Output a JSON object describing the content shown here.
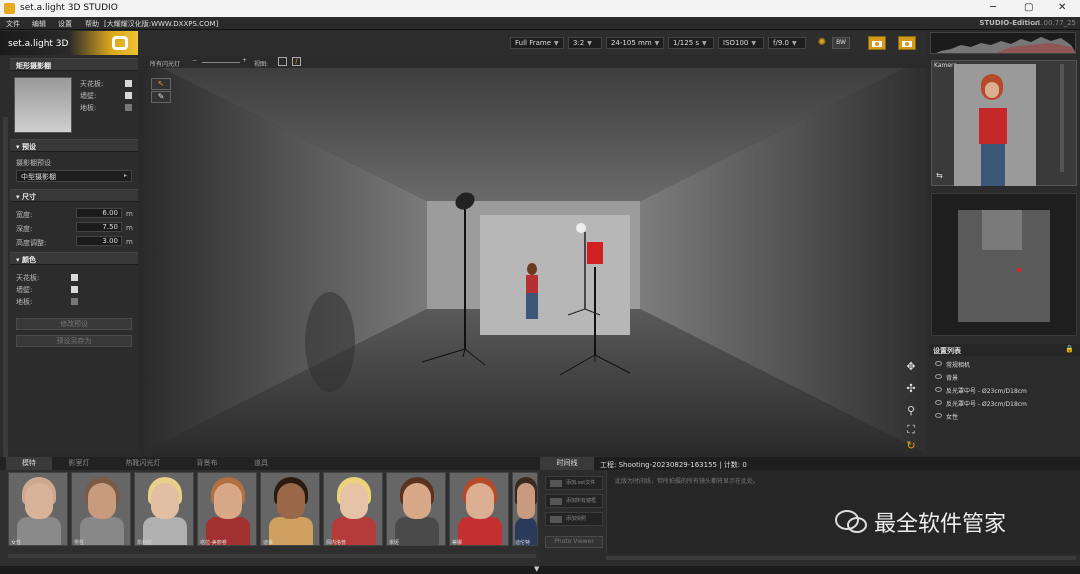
{
  "window": {
    "title": "set.a.light 3D STUDIO"
  },
  "menu": {
    "items": [
      "文件",
      "编辑",
      "设置",
      "帮助",
      "[大耀耀汉化版:WWW.DXXPS.COM]"
    ],
    "edition": "STUDIO-Edition",
    "version": "v1.00.77_25"
  },
  "brand": {
    "text": "set.a.light 3D",
    "sup": "STUDIO"
  },
  "toolbar": {
    "frame": "Full Frame",
    "ratio": "3:2",
    "lens": "24-105 mm",
    "shutter": "1/125 s",
    "iso": "ISO100",
    "aperture": "f/9.0",
    "bw": "BW"
  },
  "left": {
    "room_header": "矩形摄影棚",
    "room_opts": [
      "天花板:",
      "墙壁:",
      "地板:"
    ],
    "preset_header": "预设",
    "preset_label": "摄影棚预设",
    "preset_value": "中型摄影棚",
    "size_header": "尺寸",
    "size": [
      {
        "label": "宽度:",
        "value": "6.00",
        "unit": "m"
      },
      {
        "label": "深度:",
        "value": "7.50",
        "unit": "m"
      },
      {
        "label": "高度调整:",
        "value": "3.00",
        "unit": "m"
      }
    ],
    "color_header": "颜色",
    "color_opts": [
      "天花板:",
      "墙壁:",
      "地板:"
    ],
    "btn_modify": "修改预设",
    "btn_saveas": "预设另存为"
  },
  "viewport": {
    "flash_label": "所有闪光灯",
    "view_label": "视图:"
  },
  "right": {
    "camera_label": "Kamera",
    "settings_header": "设置列表",
    "settings": [
      "常规相机",
      "背景",
      "反光罩中号 - Ø23cm/D18cm",
      "反光罩中号 - Ø23cm/D18cm",
      "女性"
    ]
  },
  "bottom": {
    "tabs": [
      "模特",
      "影室灯",
      "热靴闪光灯",
      "背景布",
      "道具"
    ],
    "models": [
      {
        "label": "女性",
        "skin": "#d9b29a",
        "hair": "#cfa98f",
        "shirt": "#8a8a8a"
      },
      {
        "label": "男性",
        "skin": "#c89a7e",
        "hair": "#7a5a44",
        "shirt": "#888"
      },
      {
        "label": "凯利尔",
        "skin": "#e2bfa2",
        "hair": "#e8d08a",
        "shirt": "#b0b0b0"
      },
      {
        "label": "塔拉-美丽卷",
        "skin": "#d8a888",
        "hair": "#b07040",
        "shirt": "#a13030"
      },
      {
        "label": "迪莱",
        "skin": "#9a6848",
        "hair": "#2a1a10",
        "shirt": "#d0a060"
      },
      {
        "label": "佩内洛普",
        "skin": "#e6c3a6",
        "hair": "#ecd27a",
        "shirt": "#b53a3a"
      },
      {
        "label": "米娅",
        "skin": "#d8a888",
        "hair": "#5a3320",
        "shirt": "#4a4a4a"
      },
      {
        "label": "蒂娜",
        "skin": "#dcae92",
        "hair": "#b54a2a",
        "shirt": "#c43030"
      },
      {
        "label": "迪伦特",
        "skin": "#c89a7e",
        "hair": "#3a2a20",
        "shirt": "#2a3a5a"
      }
    ]
  },
  "timeline": {
    "tab": "时间线",
    "project": "工程: Shooting-20230829-163155 | 计数: 0",
    "hint": "此版为时间线，但所拍摄的所有镜头都将显示在此处。",
    "buttons": [
      "添加.set文件",
      "添加所有镜框",
      "添加快照"
    ],
    "photo_viewer": "Photo Viewer"
  },
  "watermark": "最全软件管家",
  "colors": {
    "accent": "#d9a51e",
    "red_light": "#e02020"
  }
}
